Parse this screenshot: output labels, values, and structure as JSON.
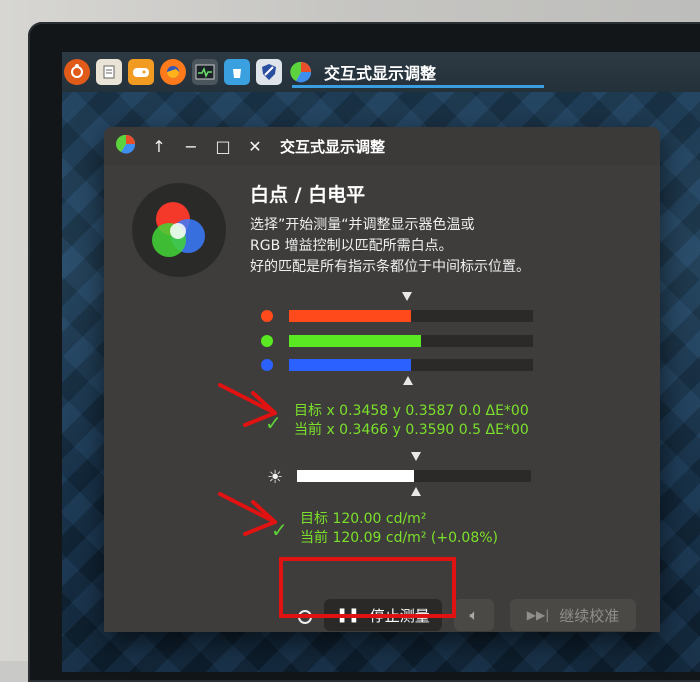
{
  "taskbar": {
    "active_title": "交互式显示调整",
    "icons": [
      "ubuntu-icon",
      "text-editor-icon",
      "game-controller-icon",
      "firefox-icon",
      "system-monitor-icon",
      "software-center-icon",
      "shield-app-icon",
      "display-calibration-icon"
    ]
  },
  "window": {
    "title": "交互式显示调整",
    "controls": [
      "↑",
      "−",
      "□",
      "✕"
    ]
  },
  "panel": {
    "heading": "白点 / 白电平",
    "description": [
      "选择”开始测量“并调整显示器色温或",
      "RGB 增益控制以匹配所需白点。",
      "好的匹配是所有指示条都位于中间标示位置。"
    ]
  },
  "rgb_bars": {
    "red": {
      "fill": 0.5,
      "color": "#ff4a1c"
    },
    "green": {
      "fill": 0.54,
      "color": "#59e821"
    },
    "blue": {
      "fill": 0.5,
      "color": "#2b62ff"
    }
  },
  "whitepoint_readout": {
    "target": "目标 x 0.3458 y 0.3587 0.0 ΔE*00",
    "current": "当前 x 0.3466 y 0.3590 0.5 ΔE*00"
  },
  "luminance": {
    "fill": 0.5,
    "target": "目标 120.00 cd/m²",
    "current": "当前 120.09 cd/m² (+0.08%)"
  },
  "buttons": {
    "stop": "停止测量",
    "continue": "继续校准"
  },
  "colors": {
    "accent_green": "#7be02b",
    "highlight_red": "#e01212",
    "taskbar_underline": "#3a9fe0"
  }
}
